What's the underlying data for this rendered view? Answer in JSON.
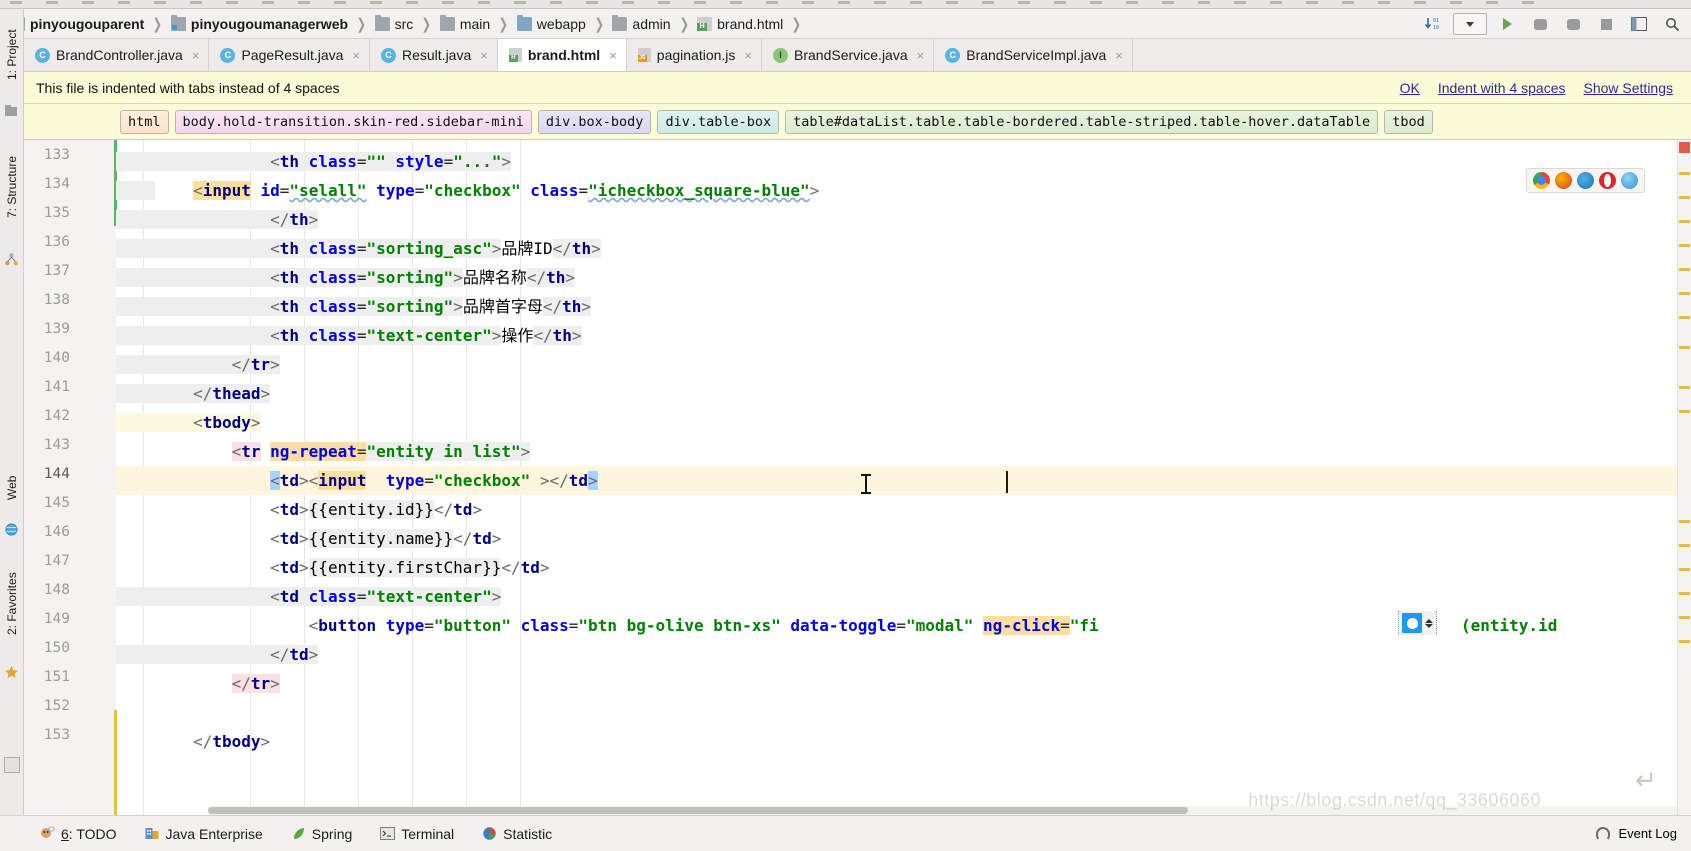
{
  "breadcrumb": {
    "items": [
      {
        "label": "pinyougouparent",
        "icon": "module-icon",
        "bold": true
      },
      {
        "label": "pinyougoumanagerweb",
        "icon": "module-icon",
        "bold": true
      },
      {
        "label": "src",
        "icon": "folder-icon",
        "bold": false
      },
      {
        "label": "main",
        "icon": "folder-icon",
        "bold": false
      },
      {
        "label": "webapp",
        "icon": "folder-blue-icon",
        "bold": false
      },
      {
        "label": "admin",
        "icon": "folder-icon",
        "bold": false
      },
      {
        "label": "brand.html",
        "icon": "html-file-icon",
        "bold": false
      }
    ],
    "separator": "❯"
  },
  "toolbar_right": {
    "download_label": "↓↓",
    "config_selector": "",
    "run_label": "▶",
    "debug_label": "",
    "stop_label": "",
    "layout_label": ""
  },
  "left_tools": {
    "project_label": "1: Project",
    "structure_label": "7: Structure",
    "web_label": "Web",
    "favorites_label": "2: Favorites"
  },
  "tabs": [
    {
      "label": "BrandController.java",
      "icon": "java-class-icon",
      "badge": "C",
      "active": false
    },
    {
      "label": "PageResult.java",
      "icon": "java-class-icon",
      "badge": "C",
      "active": false
    },
    {
      "label": "Result.java",
      "icon": "java-class-icon",
      "badge": "C",
      "active": false
    },
    {
      "label": "brand.html",
      "icon": "html-file-icon",
      "badge": "",
      "active": true
    },
    {
      "label": "pagination.js",
      "icon": "js-file-icon",
      "badge": "",
      "active": false
    },
    {
      "label": "BrandService.java",
      "icon": "java-interface-icon",
      "badge": "I",
      "active": false
    },
    {
      "label": "BrandServiceImpl.java",
      "icon": "java-class-icon",
      "badge": "C",
      "active": false
    }
  ],
  "tab_close_glyph": "×",
  "notification": {
    "message": "This file is indented with tabs instead of 4 spaces",
    "actions": [
      "OK",
      "Indent with 4 spaces",
      "Show Settings"
    ]
  },
  "element_path": [
    "html",
    "body.hold-transition.skin-red.sidebar-mini",
    "div.box-body",
    "div.table-box",
    "table#dataList.table.table-bordered.table-striped.table-hover.dataTable",
    "tbod"
  ],
  "editor": {
    "first_line_number": 133,
    "lines": [
      {
        "n": 133,
        "text": "            <th class=\"\" style=\"...\">"
      },
      {
        "n": 134,
        "text": "                <input id=\"selall\" type=\"checkbox\" class=\"icheckbox_square-blue\">"
      },
      {
        "n": 135,
        "text": "            </th>"
      },
      {
        "n": 136,
        "text": "            <th class=\"sorting_asc\">品牌ID</th>"
      },
      {
        "n": 137,
        "text": "            <th class=\"sorting\">品牌名称</th>"
      },
      {
        "n": 138,
        "text": "            <th class=\"sorting\">品牌首字母</th>"
      },
      {
        "n": 139,
        "text": "            <th class=\"text-center\">操作</th>"
      },
      {
        "n": 140,
        "text": "        </tr>"
      },
      {
        "n": 141,
        "text": "    </thead>"
      },
      {
        "n": 142,
        "text": "    <tbody>"
      },
      {
        "n": 143,
        "text": "        <tr ng-repeat=\"entity in list\">"
      },
      {
        "n": 144,
        "text": "            <td><input  type=\"checkbox\" ></td>"
      },
      {
        "n": 145,
        "text": "            <td>{{entity.id}}</td>"
      },
      {
        "n": 146,
        "text": "            <td>{{entity.name}}</td>"
      },
      {
        "n": 147,
        "text": "            <td>{{entity.firstChar}}</td>"
      },
      {
        "n": 148,
        "text": "            <td class=\"text-center\">"
      },
      {
        "n": 149,
        "text": "                <button type=\"button\" class=\"btn bg-olive btn-xs\" data-toggle=\"modal\" ng-click=\"fi  □ ↕ (entity.id"
      },
      {
        "n": 150,
        "text": "                </td>"
      },
      {
        "n": 151,
        "text": "        </tr>"
      },
      {
        "n": 152,
        "text": ""
      },
      {
        "n": 153,
        "text": "    </tbody>"
      }
    ],
    "caret_line": 144,
    "highlighted_line": 144
  },
  "browser_icons": [
    "chrome-icon",
    "firefox-icon",
    "edge-icon",
    "opera-icon",
    "safari-icon"
  ],
  "status_bar": {
    "items": [
      {
        "label": "6: TODO",
        "icon": "todo-icon"
      },
      {
        "label": "Java Enterprise",
        "icon": "java-enterprise-icon"
      },
      {
        "label": "Spring",
        "icon": "spring-leaf-icon"
      },
      {
        "label": "Terminal",
        "icon": "terminal-icon"
      },
      {
        "label": "Statistic",
        "icon": "statistic-icon"
      }
    ],
    "event_log": "Event Log"
  },
  "watermark": "https://blog.csdn.net/qq_33606060",
  "colors": {
    "notification_bg": "#fcfbd8",
    "link": "#2b2b9e",
    "tag": "#000082",
    "attribute": "#0000e0",
    "value": "#008000",
    "highlight_line": "#fdf6dd",
    "selection": "#a6d2ff"
  }
}
